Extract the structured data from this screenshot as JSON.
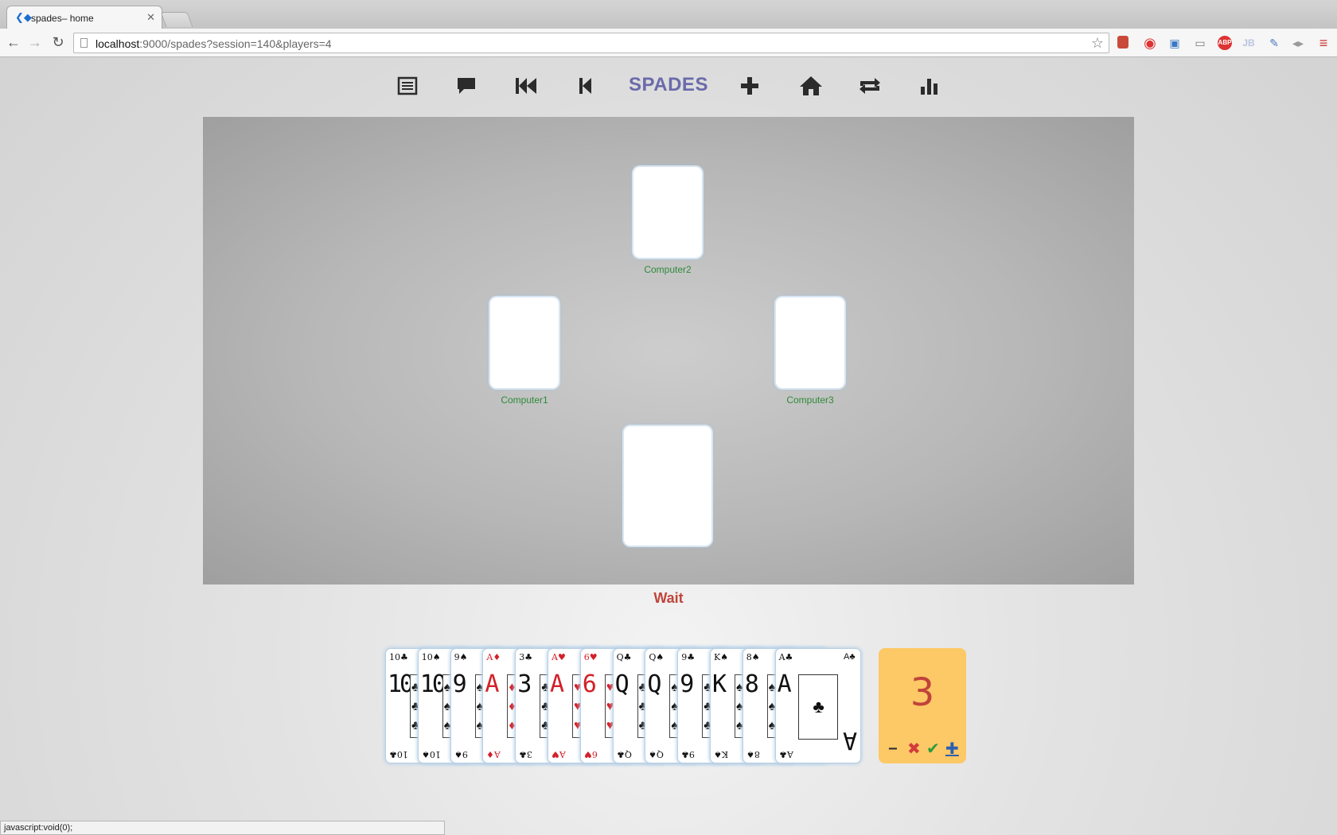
{
  "browser": {
    "tab_title": "spades– home",
    "url_host": "localhost",
    "url_rest": ":9000/spades?session=140&players=4",
    "status_text": "javascript:void(0);"
  },
  "nav": {
    "brand": "SPADES",
    "icons": [
      "list-icon",
      "chat-icon",
      "first-icon",
      "previous-icon",
      "plus-icon",
      "home-icon",
      "repeat-icon",
      "stats-icon"
    ]
  },
  "table": {
    "players": [
      {
        "name": "Computer2"
      },
      {
        "name": "Computer1"
      },
      {
        "name": "Computer3"
      }
    ]
  },
  "status": "Wait",
  "hand": [
    {
      "rank": "10",
      "suit": "♣",
      "color": "black"
    },
    {
      "rank": "10",
      "suit": "♠",
      "color": "black"
    },
    {
      "rank": "9",
      "suit": "♠",
      "color": "black"
    },
    {
      "rank": "A",
      "suit": "♦",
      "color": "red"
    },
    {
      "rank": "3",
      "suit": "♣",
      "color": "black"
    },
    {
      "rank": "A",
      "suit": "♥",
      "color": "red"
    },
    {
      "rank": "6",
      "suit": "♥",
      "color": "red"
    },
    {
      "rank": "Q",
      "suit": "♣",
      "color": "black"
    },
    {
      "rank": "Q",
      "suit": "♠",
      "color": "black"
    },
    {
      "rank": "9",
      "suit": "♣",
      "color": "black"
    },
    {
      "rank": "K",
      "suit": "♠",
      "color": "black"
    },
    {
      "rank": "8",
      "suit": "♠",
      "color": "black"
    },
    {
      "rank": "A",
      "suit": "♣",
      "color": "black"
    }
  ],
  "bid": {
    "value": "3",
    "minus": "−",
    "cancel": "✖",
    "confirm": "✔",
    "plus": "✚"
  },
  "colors": {
    "brand": "#6a6aaa",
    "player_name": "#2e8b3a",
    "status": "#c0443a",
    "bid_bg": "#fdc866"
  }
}
